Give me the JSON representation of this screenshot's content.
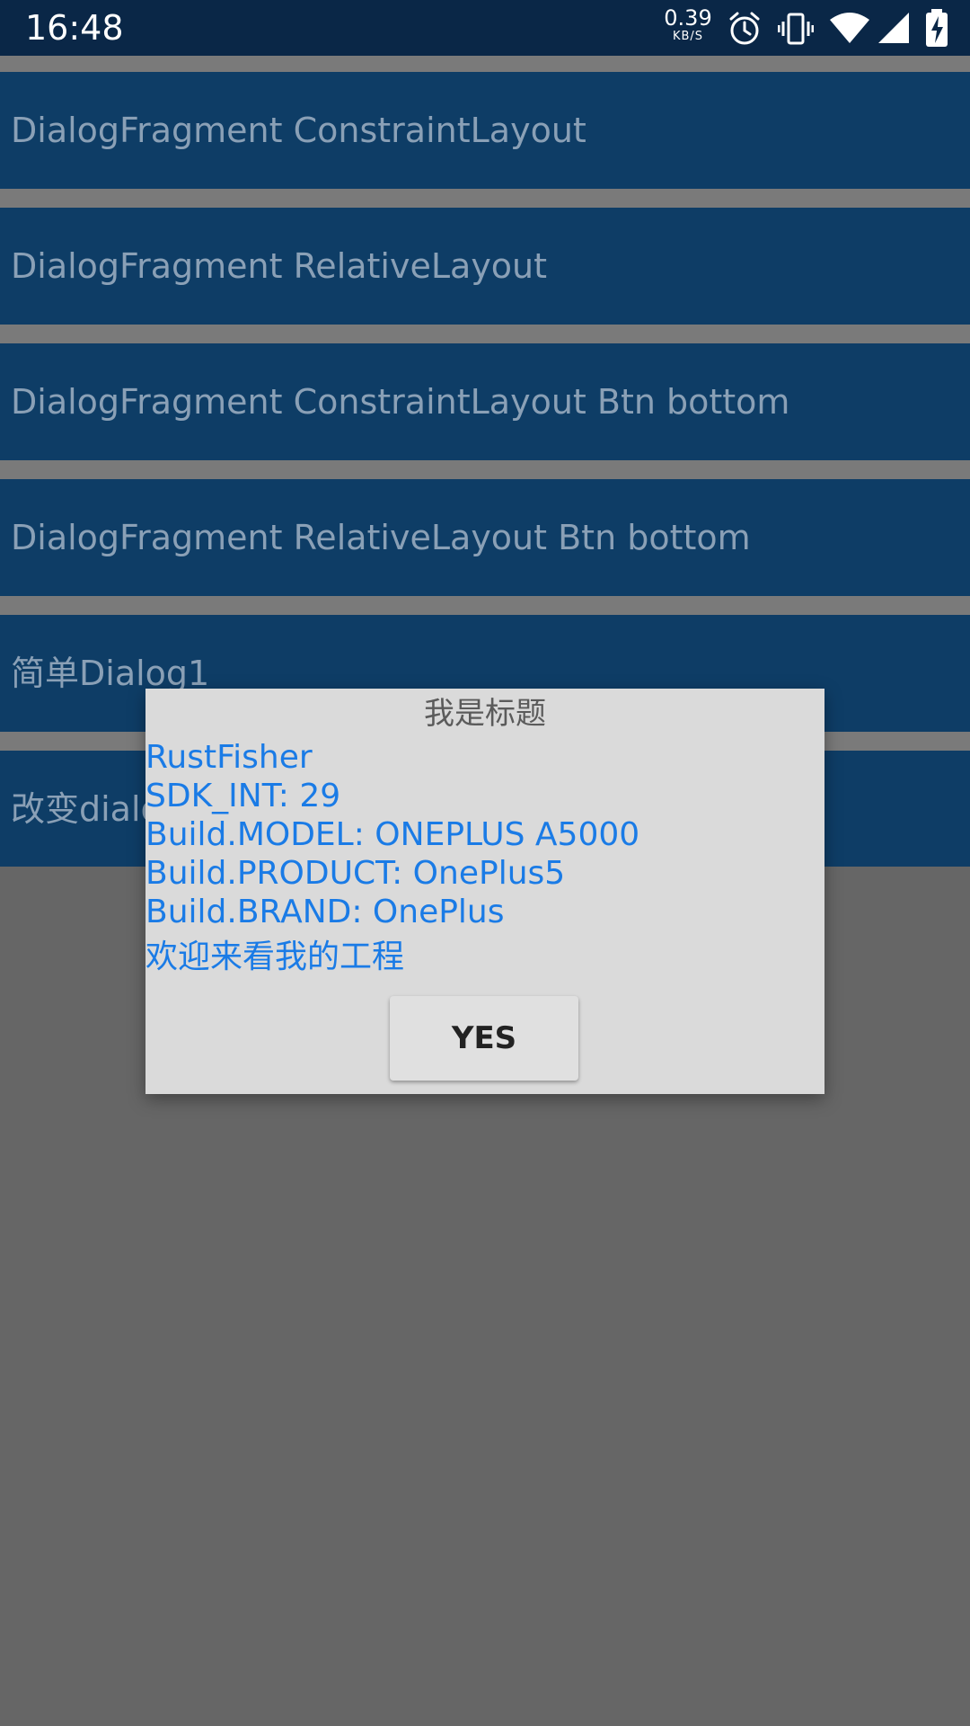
{
  "status_bar": {
    "time": "16:48",
    "net_speed_value": "0.39",
    "net_speed_unit": "KB/S",
    "icons": [
      "alarm-icon",
      "vibrate-icon",
      "wifi-icon",
      "signal-icon",
      "battery-charging-icon"
    ]
  },
  "list": {
    "buttons": [
      {
        "label": "DialogFragment ConstraintLayout"
      },
      {
        "label": "DialogFragment RelativeLayout"
      },
      {
        "label": "DialogFragment ConstraintLayout Btn bottom"
      },
      {
        "label": "DialogFragment RelativeLayout Btn bottom"
      },
      {
        "label": "简单Dialog1"
      },
      {
        "label": "改变dialog"
      }
    ]
  },
  "dialog": {
    "title": "我是标题",
    "lines": [
      "RustFisher",
      "SDK_INT: 29",
      "Build.MODEL: ONEPLUS A5000",
      "Build.PRODUCT: OnePlus5",
      "Build.BRAND: OnePlus",
      "欢迎来看我的工程"
    ],
    "yes_label": "YES"
  },
  "colors": {
    "status_bar": "#0a2747",
    "button_bg": "#0e3d66",
    "button_text": "#8aa0b6",
    "divider": "#7a7a7a",
    "dim_background": "#666666",
    "dialog_bg": "#dadada",
    "info_text": "#1a7be6"
  }
}
